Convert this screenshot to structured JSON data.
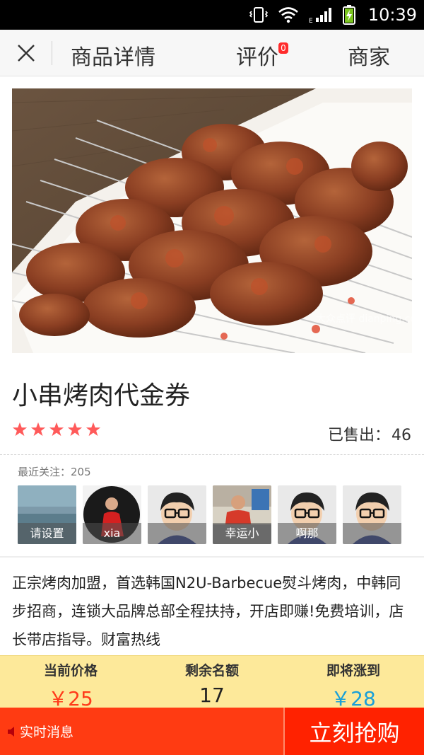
{
  "status_bar": {
    "time": "10:39",
    "network": "E"
  },
  "header": {
    "tabs": [
      {
        "label": "商品详情"
      },
      {
        "label": "评价",
        "badge": "0"
      },
      {
        "label": "商家"
      }
    ]
  },
  "product": {
    "title": "小串烤肉代金券",
    "rating_stars": 5,
    "sold_label": "已售出：",
    "sold_count": "46",
    "image_watermark": "大众点评 dianping.com"
  },
  "followers": {
    "label": "最近关注：205",
    "items": [
      {
        "caption": "请设置",
        "avatar": "landscape-photo"
      },
      {
        "caption": "xia",
        "avatar": "person-red-photo"
      },
      {
        "caption": "",
        "avatar": "default-cartoon"
      },
      {
        "caption": "幸运小",
        "avatar": "person-office-photo"
      },
      {
        "caption": "啊那",
        "avatar": "default-cartoon"
      },
      {
        "caption": "",
        "avatar": "default-cartoon"
      }
    ]
  },
  "description": "正宗烤肉加盟，首选韩国N2U-Barbecue熨斗烤肉，中韩同步招商，连锁大品牌总部全程扶持，开店即赚!免费培训，店长带店指导。财富热线",
  "price_bar": {
    "current_label": "当前价格",
    "current_value": "￥25",
    "remaining_label": "剩余名额",
    "remaining_value": "17",
    "next_label": "即将涨到",
    "next_value": "￥28"
  },
  "bottom_bar": {
    "news_label": "实时消息",
    "buy_label": "立刻抢购"
  },
  "colors": {
    "accent_red": "#ff2200",
    "price_red": "#ff3a1a",
    "next_blue": "#1aa0d8",
    "price_bar_bg": "#fde99a",
    "star": "#ff5a5a"
  }
}
